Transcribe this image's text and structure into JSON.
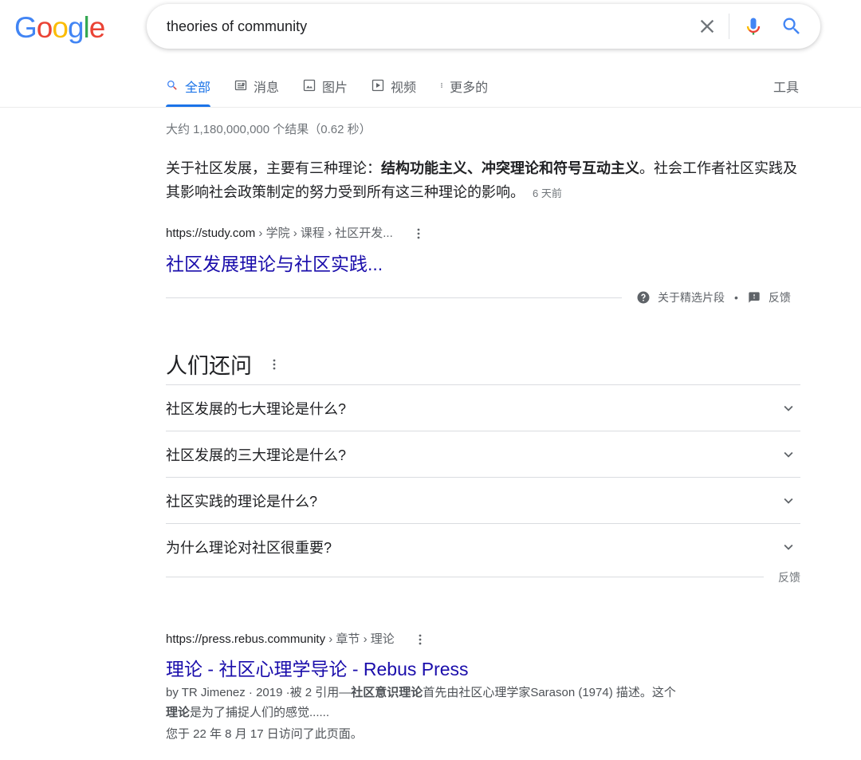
{
  "logo": {
    "letters": [
      "G",
      "o",
      "o",
      "g",
      "l",
      "e"
    ],
    "colors": [
      "#4285F4",
      "#EA4335",
      "#FBBC05",
      "#4285F4",
      "#34A853",
      "#EA4335"
    ]
  },
  "search": {
    "query": "theories of community"
  },
  "tabs": [
    {
      "label": "全部",
      "icon": "search-icon",
      "active": true
    },
    {
      "label": "消息",
      "icon": "news-icon"
    },
    {
      "label": "图片",
      "icon": "image-icon"
    },
    {
      "label": "视频",
      "icon": "video-icon"
    },
    {
      "label": "更多的",
      "icon": "more-vert-icon"
    }
  ],
  "tools_label": "工具",
  "stats": "大约 1,180,000,000 个结果（0.62 秒）",
  "featured": {
    "text_before": "关于社区发展，主要有三种理论：",
    "text_bold": "结构功能主义、冲突理论和符号互动主义",
    "text_after": "。社会工作者社区实践及其影响社会政策制定的努力受到所有这三种理论的影响。",
    "date": "6 天前",
    "url_domain": "https://study.com",
    "url_path": " › 学院 › 课程 › 社区开发...",
    "title": "社区发展理论与社区实践...",
    "about_label": "关于精选片段",
    "bullet": "•",
    "feedback_label": "反馈"
  },
  "paa": {
    "title": "人们还问",
    "questions": [
      "社区发展的七大理论是什么?",
      "社区发展的三大理论是什么?",
      "社区实践的理论是什么?",
      "为什么理论对社区很重要?"
    ],
    "feedback_label": "反馈"
  },
  "result2": {
    "url_domain": "https://press.rebus.community",
    "url_path": " › 章节 › 理论",
    "title": "理论 - 社区心理学导论 - Rebus Press",
    "meta": "by TR Jimenez · 2019 ·被 2 引用—",
    "snip_b1": "社区意识理论",
    "snip_t1": "首先由社区心理学家Sarason (1974) 描述。这个",
    "snip_b2": "理论",
    "snip_t2": "是为了捕捉人们的感觉......",
    "visited": "您于 22 年 8 月 17 日访问了此页面。"
  }
}
